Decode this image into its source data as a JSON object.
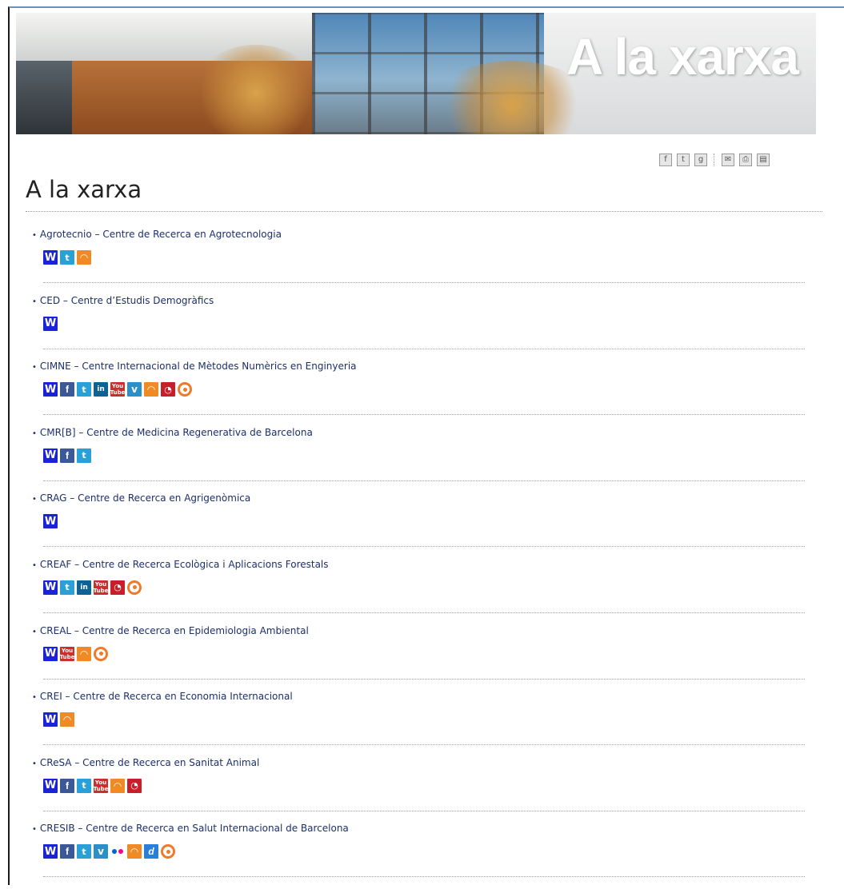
{
  "banner": {
    "title": "A la xarxa"
  },
  "share_toolbar": {
    "icons": [
      "facebook-share-icon",
      "twitter-share-icon",
      "google-plus-share-icon",
      "email-icon",
      "print-icon",
      "pdf-icon"
    ]
  },
  "page": {
    "title": "A la xarxa"
  },
  "colors": {
    "link": "#1c2f6b",
    "wordpress": "#1a23d6",
    "facebook": "#3b5998",
    "twitter": "#2a9fd8",
    "linkedin": "#0f6296",
    "youtube": "#c9302c",
    "vimeo": "#2c8fc7",
    "rss": "#f08a24",
    "podcast": "#c81e2a",
    "issuu": "#f07a2a"
  },
  "entries": [
    {
      "name": "Agrotecnio – Centre de Recerca en Agrotecnologia",
      "icons": [
        "web",
        "twitter",
        "rss"
      ]
    },
    {
      "name": "CED – Centre d’Estudis Demogràfics",
      "icons": [
        "web"
      ]
    },
    {
      "name": "CIMNE – Centre Internacional de Mètodes Numèrics en Enginyeria",
      "icons": [
        "web",
        "facebook",
        "twitter",
        "linkedin",
        "youtube",
        "vimeo",
        "rss",
        "podcast",
        "issuu"
      ]
    },
    {
      "name": "CMR[B] – Centre de Medicina Regenerativa de Barcelona",
      "icons": [
        "web",
        "facebook",
        "twitter"
      ]
    },
    {
      "name": "CRAG – Centre de Recerca en Agrigenòmica",
      "icons": [
        "web"
      ]
    },
    {
      "name": "CREAF – Centre de Recerca Ecològica i Aplicacions Forestals",
      "icons": [
        "web",
        "twitter",
        "linkedin",
        "youtube",
        "podcast",
        "issuu"
      ]
    },
    {
      "name": "CREAL – Centre de Recerca en Epidemiologia Ambiental",
      "icons": [
        "web",
        "youtube",
        "rss",
        "issuu"
      ]
    },
    {
      "name": "CREI – Centre de Recerca en Economia Internacional",
      "icons": [
        "web",
        "rss"
      ]
    },
    {
      "name": "CReSA – Centre de Recerca en Sanitat Animal",
      "icons": [
        "web",
        "facebook",
        "twitter",
        "youtube",
        "rss",
        "podcast"
      ]
    },
    {
      "name": "CRESIB – Centre de Recerca en Salut Internacional de Barcelona",
      "icons": [
        "web",
        "facebook",
        "twitter",
        "vimeo",
        "flickr",
        "rss",
        "delicious",
        "issuu"
      ]
    }
  ]
}
